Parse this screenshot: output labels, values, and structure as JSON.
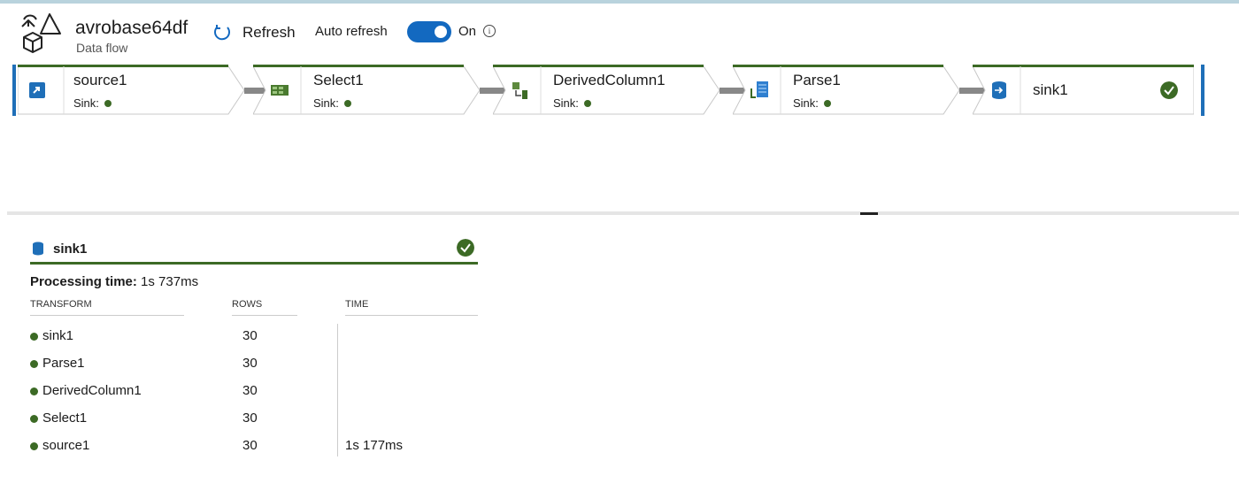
{
  "header": {
    "title": "avrobase64df",
    "subtitle": "Data flow",
    "refresh_label": "Refresh",
    "auto_refresh_label": "Auto refresh",
    "toggle_state": "On",
    "info_glyph": "i"
  },
  "pipeline": {
    "nodes": [
      {
        "name": "source1",
        "status": "Sink:",
        "icon": "source-database-icon"
      },
      {
        "name": "Select1",
        "status": "Sink:",
        "icon": "select-columns-icon"
      },
      {
        "name": "DerivedColumn1",
        "status": "Sink:",
        "icon": "derived-column-icon"
      },
      {
        "name": "Parse1",
        "status": "Sink:",
        "icon": "parse-icon"
      }
    ],
    "sink": {
      "name": "sink1",
      "icon": "sink-database-icon",
      "status_icon": "success-check-icon"
    }
  },
  "details": {
    "name": "sink1",
    "processing_label": "Processing time:",
    "processing_value": "1s 737ms",
    "columns": [
      "TRANSFORM",
      "ROWS",
      "TIME"
    ],
    "rows": [
      {
        "transform": "sink1",
        "rows": "30",
        "time": ""
      },
      {
        "transform": "Parse1",
        "rows": "30",
        "time": ""
      },
      {
        "transform": "DerivedColumn1",
        "rows": "30",
        "time": ""
      },
      {
        "transform": "Select1",
        "rows": "30",
        "time": ""
      },
      {
        "transform": "source1",
        "rows": "30",
        "time": "1s 177ms"
      }
    ]
  },
  "colors": {
    "accent": "#1369c0",
    "success": "#3c6a25",
    "bar": "#1f6fb8"
  }
}
